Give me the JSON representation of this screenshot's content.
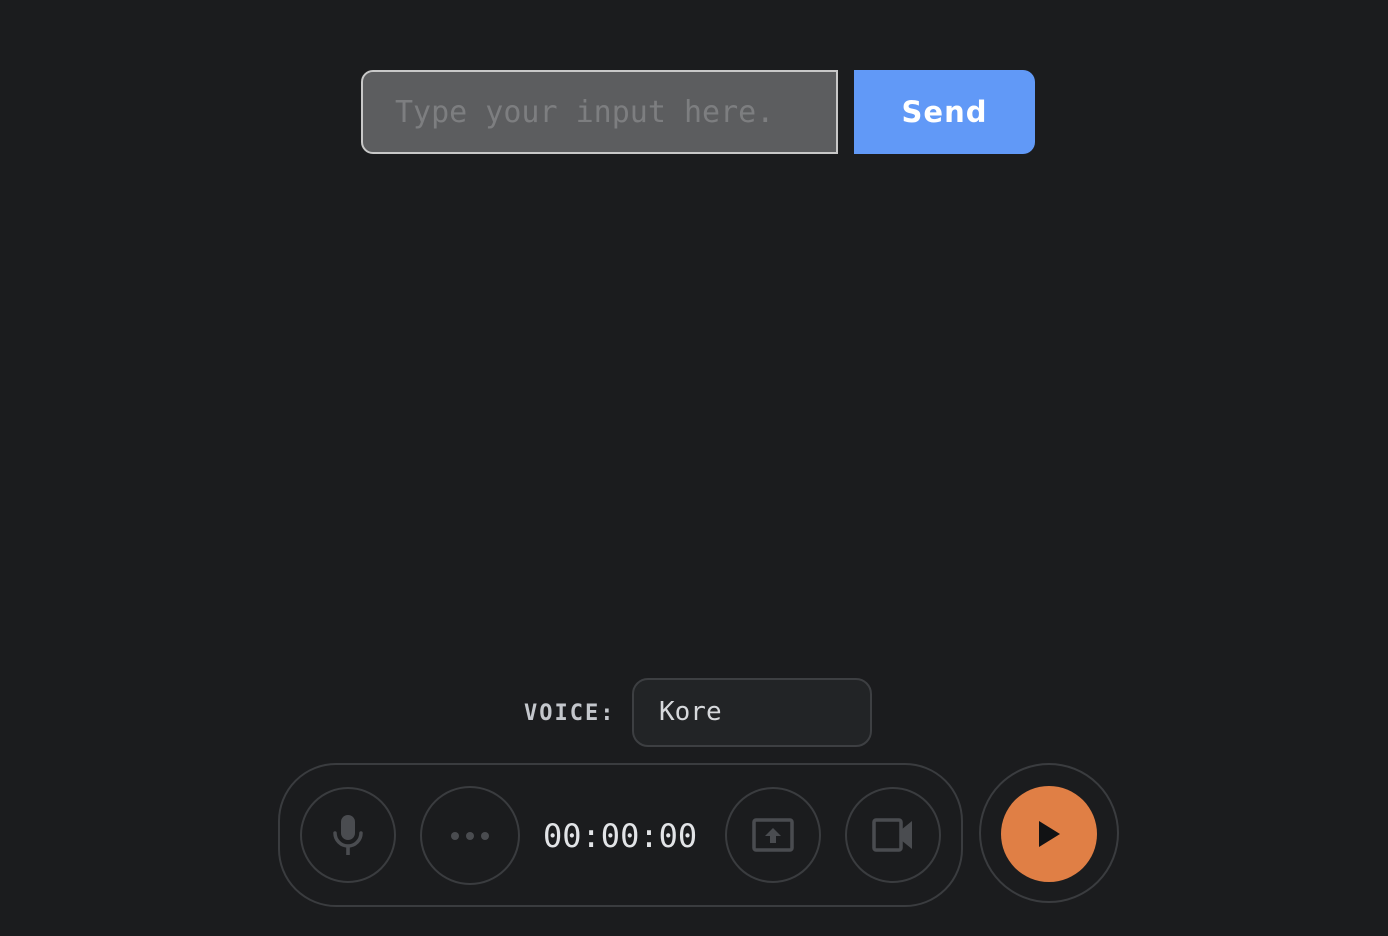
{
  "input": {
    "value": "",
    "placeholder": "Type your input here."
  },
  "send": {
    "label": "Send"
  },
  "voice": {
    "label": "VOICE:",
    "selected": "Kore"
  },
  "controls": {
    "timer": "00:00:00",
    "icons": [
      "mic-icon",
      "more-dots-icon",
      "screen-share-icon",
      "video-camera-icon",
      "play-icon"
    ]
  },
  "colors": {
    "background": "#1b1c1e",
    "send_button": "#6199f7",
    "play_button": "#e07f45",
    "input_fill": "#5c5d5f"
  }
}
